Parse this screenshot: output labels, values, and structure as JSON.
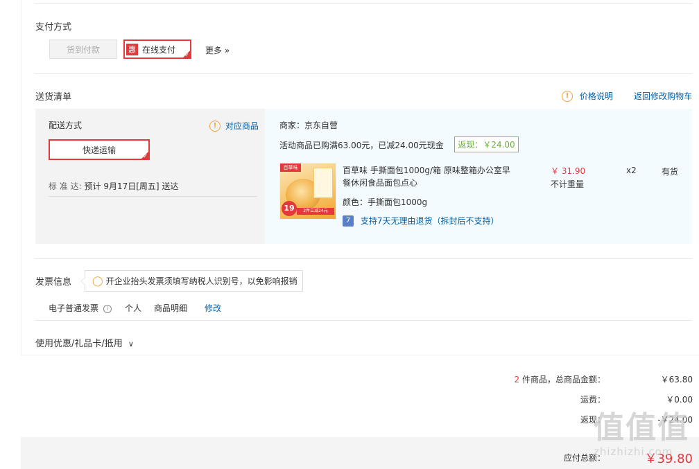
{
  "payment": {
    "title": "支付方式",
    "cod_label": "货到付款",
    "online_badge": "惠",
    "online_label": "在线支付",
    "more_label": "更多 »"
  },
  "delivery": {
    "title": "送货清单",
    "price_note": "价格说明",
    "back_cart": "返回修改购物车",
    "method_title": "配送方式",
    "related_goods": "对应商品",
    "express_label": "快递运输",
    "eta_label": "标 准 达:",
    "eta_value": "预计 9月17日[周五] 送达",
    "seller": "商家：京东自营",
    "promo_text": "活动商品已购满63.00元，已减24.00元现金",
    "cashback": "返现：￥24.00",
    "product": {
      "name_line1": "百草味 手撕面包1000g/箱 原味整箱办公室早",
      "name_line2": "餐休闲食品面包点心",
      "color": "颜色：手撕面包1000g",
      "return_badge": "7",
      "return_policy": "支持7天无理由退货（拆封后不支持）",
      "price": "￥ 31.90",
      "weight": "不计重量",
      "qty": "x2",
      "stock": "有货",
      "thumb_logo": "百草味",
      "thumb_num": "19",
      "thumb_tag": "2件立减24元"
    }
  },
  "invoice": {
    "title": "发票信息",
    "tip": "开企业抬头发票须填写纳税人识别号，以免影响报销",
    "type": "电子普通发票",
    "info_icon": "i",
    "person": "个人",
    "detail": "商品明细",
    "modify": "修改"
  },
  "coupon": {
    "label": "使用优惠/礼品卡/抵用",
    "chevron": "∨"
  },
  "summary": {
    "count": "2",
    "count_label": "件商品，总商品金额：",
    "total": "￥63.80",
    "freight_label": "运费：",
    "freight": "￥0.00",
    "cashback_label": "返现：",
    "cashback": "-￥24.00",
    "payable_label": "应付总额：",
    "payable": "￥39.80"
  },
  "watermark": {
    "big": "值值值",
    "small": "zhizhizhi.com"
  },
  "colors": {
    "accent_red": "#e4393c",
    "link_blue": "#005ea7",
    "cashback_green": "#6aae3c",
    "warn_orange": "#f0a23a"
  }
}
